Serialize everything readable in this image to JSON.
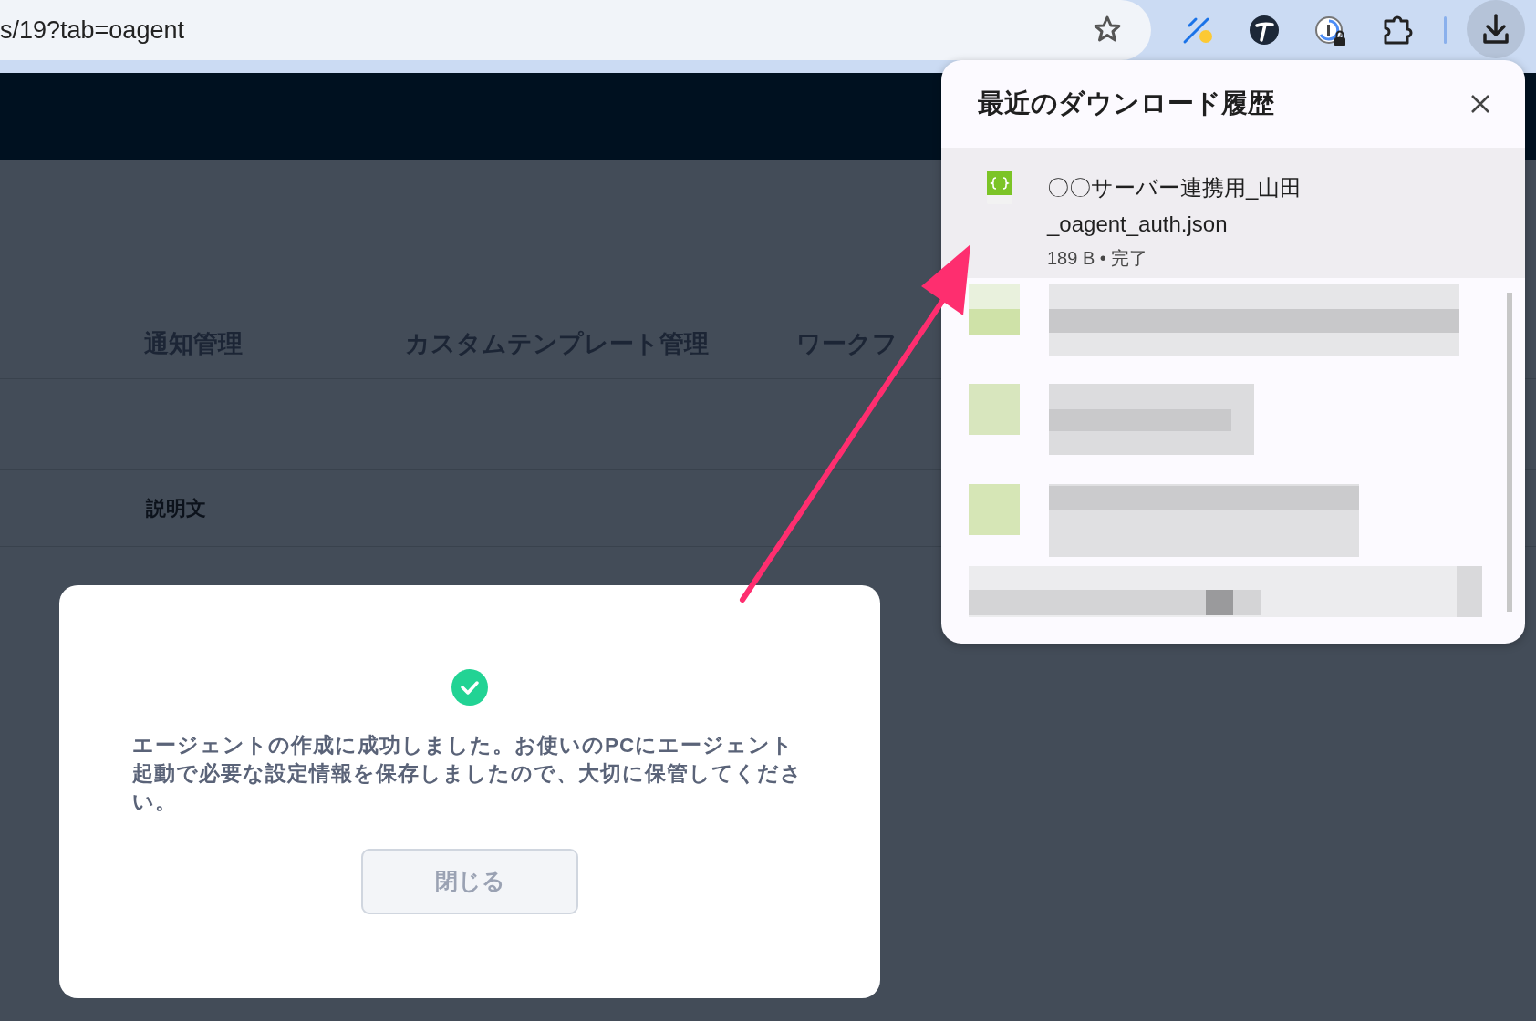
{
  "browser": {
    "address": "s/19?tab=oagent"
  },
  "tabs": [
    {
      "label": "通知管理"
    },
    {
      "label": "カスタムテンプレート管理"
    },
    {
      "label": "ワークフ"
    }
  ],
  "field_label": "説明文",
  "modal": {
    "message": "エージェントの作成に成功しました。お使いのPCにエージェント起動で必要な設定情報を保存しましたので、大切に保管してください。",
    "close_button": "閉じる"
  },
  "downloads": {
    "title": "最近のダウンロード履歴",
    "items": [
      {
        "name_lines": [
          "〇〇サーバー連携用_山田",
          "_oagent_auth.json"
        ],
        "meta": "189 B • 完了"
      }
    ]
  }
}
